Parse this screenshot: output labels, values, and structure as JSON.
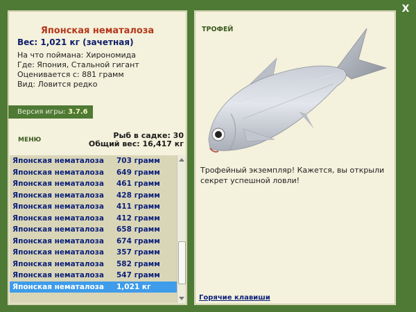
{
  "fish": {
    "title": "Японская нематалоза",
    "weight_line": "Вес: 1,021 кг (зачетная)",
    "bait": "На что поймана: Хирономида",
    "location": "Где: Япония, Стальной гигант",
    "valued": "Оценивается с: 881 грамм",
    "kind": "Вид: Ловится редко"
  },
  "version": {
    "label": "Версия игры:",
    "value": "3.7.6"
  },
  "menu_label": "МЕНЮ",
  "stats": {
    "count": "Рыб в садке: 30",
    "total": "Общий вес: 16,417 кг"
  },
  "catch_list": [
    {
      "name": "Японская нематалоза",
      "weight": "703 грамм"
    },
    {
      "name": "Японская нематалоза",
      "weight": "649 грамм"
    },
    {
      "name": "Японская нематалоза",
      "weight": "461 грамм"
    },
    {
      "name": "Японская нематалоза",
      "weight": "428 грамм"
    },
    {
      "name": "Японская нематалоза",
      "weight": "411 грамм"
    },
    {
      "name": "Японская нематалоза",
      "weight": "412 грамм"
    },
    {
      "name": "Японская нематалоза",
      "weight": "658 грамм"
    },
    {
      "name": "Японская нематалоза",
      "weight": "674 грамм"
    },
    {
      "name": "Японская нематалоза",
      "weight": "357 грамм"
    },
    {
      "name": "Японская нематалоза",
      "weight": "582 грамм"
    },
    {
      "name": "Японская нематалоза",
      "weight": "547 грамм"
    },
    {
      "name": "Японская нематалоза",
      "weight": "1,021 кг",
      "selected": true
    }
  ],
  "trophy": {
    "title": "ТРОФЕЙ",
    "text": "Трофейный экземпляр! Кажется, вы открыли секрет успешной ловли!"
  },
  "hotkeys_label": "Горячие клавиши",
  "close_label": "X",
  "colors": {
    "background": "#4e7a35",
    "panel": "#f4f1dc",
    "title": "#b5371a",
    "text_blue": "#0b1f7a",
    "selection": "#3f9cea"
  },
  "icons": {
    "close": "close-icon",
    "scroll_up": "scroll-up-arrow-icon",
    "scroll_down": "scroll-down-arrow-icon"
  }
}
